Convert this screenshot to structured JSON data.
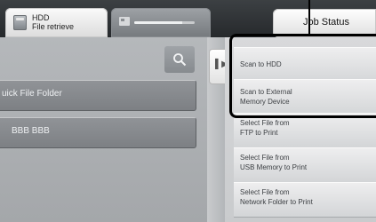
{
  "header": {
    "hdd_tab": {
      "title": "HDD",
      "subtitle": "File retrieve",
      "icon": "hdd-icon"
    },
    "job_progress": {
      "icon": "job-icon",
      "fill_percent": 80
    },
    "job_status_label": "Job Status"
  },
  "main": {
    "search_icon": "magnifier",
    "folders": [
      {
        "label": "uick File Folder"
      },
      {
        "label": "BBB BBB"
      }
    ]
  },
  "actions": [
    {
      "line1": "Scan to HDD"
    },
    {
      "line1": "Scan to External",
      "line2": "Memory Device"
    },
    {
      "line1": "Select File from",
      "line2": "FTP to Print"
    },
    {
      "line1": "Select File from",
      "line2": "USB Memory to Print"
    },
    {
      "line1": "Select File from",
      "line2": "Network Folder to Print"
    }
  ],
  "side_toggle_icon": "collapse-arrow-icon"
}
